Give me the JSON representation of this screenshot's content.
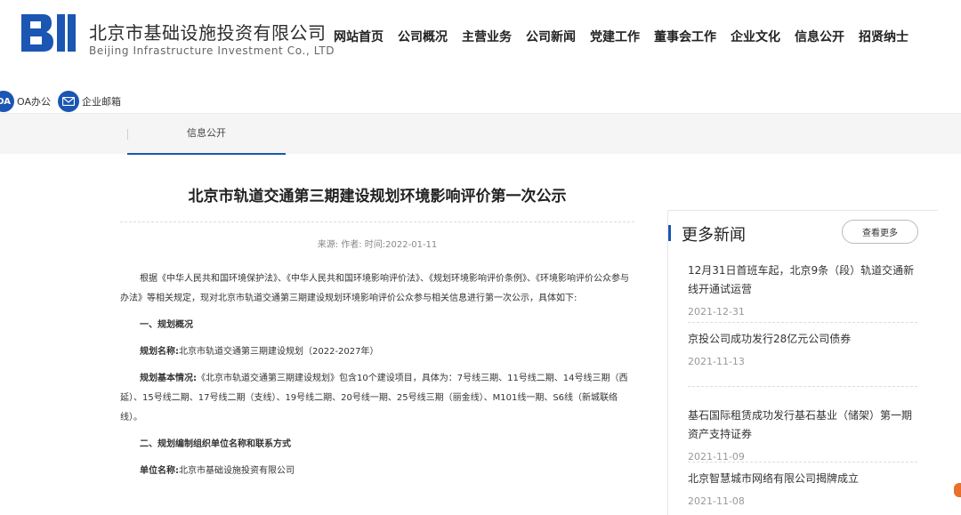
{
  "header": {
    "brand_cn": "北京市基础设施投资有限公司",
    "brand_en": "Beijing Infrastructure Investment Co., LTD",
    "logo_text": "BII",
    "brand_color": "#1b56b3",
    "nav": [
      "网站首页",
      "公司概况",
      "主营业务",
      "公司新闻",
      "党建工作",
      "董事会工作",
      "企业文化",
      "信息公开",
      "招贤纳士"
    ]
  },
  "quick_links": {
    "oa_icon": "OA",
    "oa_label": "OA办公",
    "mail_icon": "envelope-icon",
    "mail_label": "企业邮箱"
  },
  "subnav": {
    "current": "信息公开"
  },
  "article": {
    "title": "北京市轨道交通第三期建设规划环境影响评价第一次公示",
    "meta": "来源:  作者:  时间:2022-01-11",
    "p1": "根据《中华人民共和国环境保护法》、《中华人民共和国环境影响评价法》、《规划环境影响评价条例》、《环境影响评价公众参与办法》等相关规定，现对北京市轨道交通第三期建设规划环境影响评价公众参与相关信息进行第一次公示，具体如下:",
    "h1": "一、规划概况",
    "name_label": "规划名称:",
    "name_value": "北京市轨道交通第三期建设规划（2022-2027年）",
    "basic_label": "规划基本情况:",
    "basic_value": "《北京市轨道交通第三期建设规划》包含10个建设项目，具体为：7号线三期、11号线二期、14号线三期（西延）、15号线二期、17号线二期（支线）、19号线二期、20号线一期、25号线三期（丽金线）、M101线一期、S6线（新城联络线）。",
    "h2": "二、规划编制组织单位名称和联系方式",
    "unit_label": "单位名称:",
    "unit_value": "北京市基础设施投资有限公司"
  },
  "sidebar": {
    "title": "更多新闻",
    "more_label": "查看更多",
    "items": [
      {
        "title": "12月31日首班车起，北京9条（段）轨道交通新线开通试运营",
        "date": "2021-12-31"
      },
      {
        "title": "京投公司成功发行28亿元公司债券",
        "date": "2021-11-13"
      },
      {
        "title": "基石国际租赁成功发行基石基业（储架）第一期资产支持证券",
        "date": "2021-11-09"
      },
      {
        "title": "北京智慧城市网络有限公司揭牌成立",
        "date": "2021-11-08"
      }
    ]
  }
}
